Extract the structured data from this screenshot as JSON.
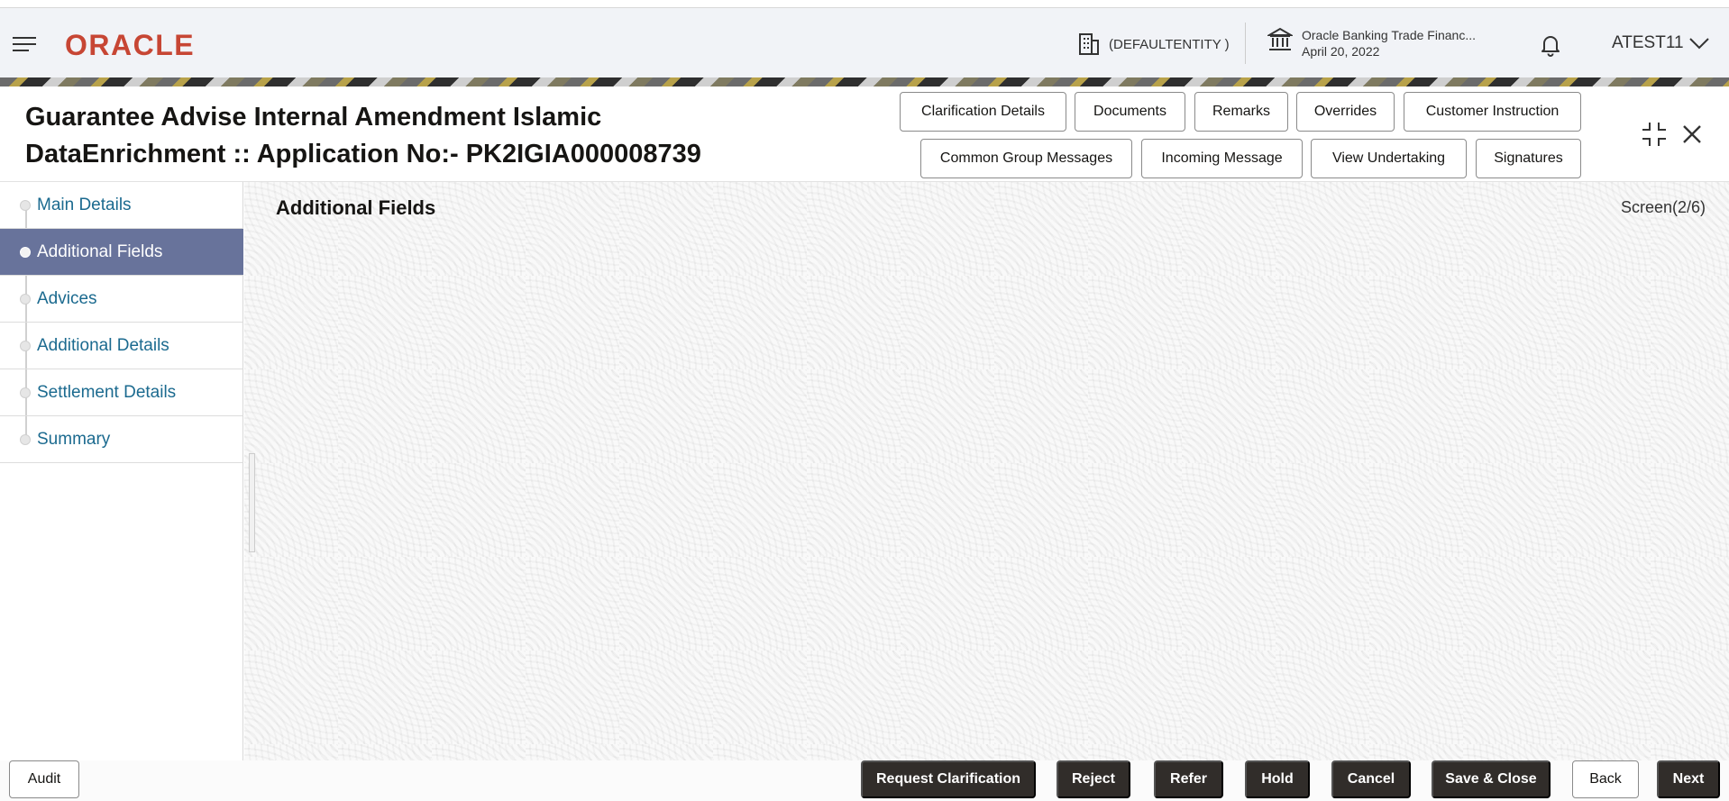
{
  "header": {
    "logo": "ORACLE",
    "entity": "(DEFAULTENTITY )",
    "bank_name": "Oracle Banking Trade Financ...",
    "date": "April 20, 2022",
    "user": "ATEST11"
  },
  "page": {
    "title_line1": "Guarantee Advise Internal Amendment Islamic",
    "title_line2": "DataEnrichment :: Application No:- PK2IGIA000008739"
  },
  "header_buttons": {
    "clarification_details": "Clarification Details",
    "documents": "Documents",
    "remarks": "Remarks",
    "overrides": "Overrides",
    "customer_instruction": "Customer Instruction",
    "common_group_messages": "Common Group Messages",
    "incoming_message": "Incoming Message",
    "view_undertaking": "View Undertaking",
    "signatures": "Signatures"
  },
  "sidebar": {
    "items": [
      {
        "label": "Main Details"
      },
      {
        "label": "Additional Fields"
      },
      {
        "label": "Advices"
      },
      {
        "label": "Additional Details"
      },
      {
        "label": "Settlement Details"
      },
      {
        "label": "Summary"
      }
    ],
    "active_index": 1
  },
  "main": {
    "section_title": "Additional Fields",
    "screen_indicator": "Screen(2/6)"
  },
  "footer": {
    "audit": "Audit",
    "request_clarification": "Request Clarification",
    "reject": "Reject",
    "refer": "Refer",
    "hold": "Hold",
    "cancel": "Cancel",
    "save_close": "Save & Close",
    "back": "Back",
    "next": "Next"
  },
  "colors": {
    "brand": "#c74634",
    "active_nav": "#68739b",
    "nav_link": "#1b6a8f",
    "primary_button": "#312d2a"
  }
}
